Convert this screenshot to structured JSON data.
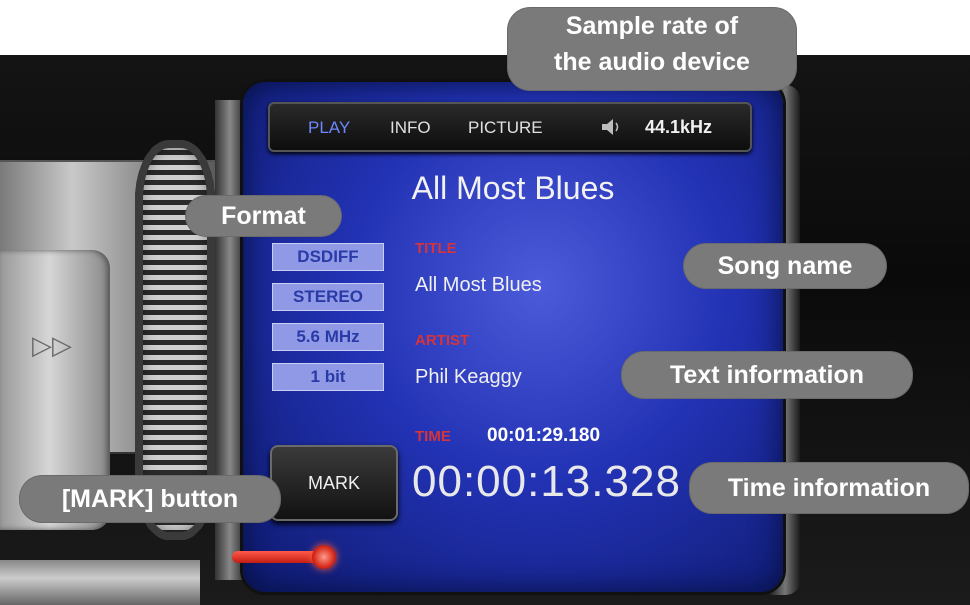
{
  "topbar": {
    "tabs": [
      {
        "label": "PLAY",
        "active": true
      },
      {
        "label": "INFO",
        "active": false
      },
      {
        "label": "PICTURE",
        "active": false
      }
    ],
    "speaker_icon": "speaker-icon",
    "sample_rate": "44.1kHz"
  },
  "song": {
    "title": "All Most Blues"
  },
  "format": {
    "items": [
      "DSDIFF",
      "STEREO",
      "5.6 MHz",
      "1 bit"
    ]
  },
  "text_info": {
    "title_label": "TITLE",
    "title_value": "All Most Blues",
    "artist_label": "ARTIST",
    "artist_value": "Phil Keaggy"
  },
  "time_info": {
    "label": "TIME",
    "total": "00:01:29.180",
    "current": "00:00:13.328"
  },
  "controls": {
    "mark_label": "MARK",
    "fast_forward_icon": "fast-forward-icon",
    "progress_fraction": 0.15
  },
  "colors": {
    "screen_blue": "#2232b4",
    "accent_red": "#d6333a",
    "active_tab": "#6d86ff",
    "callout_gray": "#7a7a7a"
  },
  "callouts": {
    "sample_rate_line1": "Sample rate of",
    "sample_rate_line2": "the audio device",
    "format": "Format",
    "song_name": "Song name",
    "text_information": "Text information",
    "time_information": "Time information",
    "mark_button": "[MARK] button"
  }
}
